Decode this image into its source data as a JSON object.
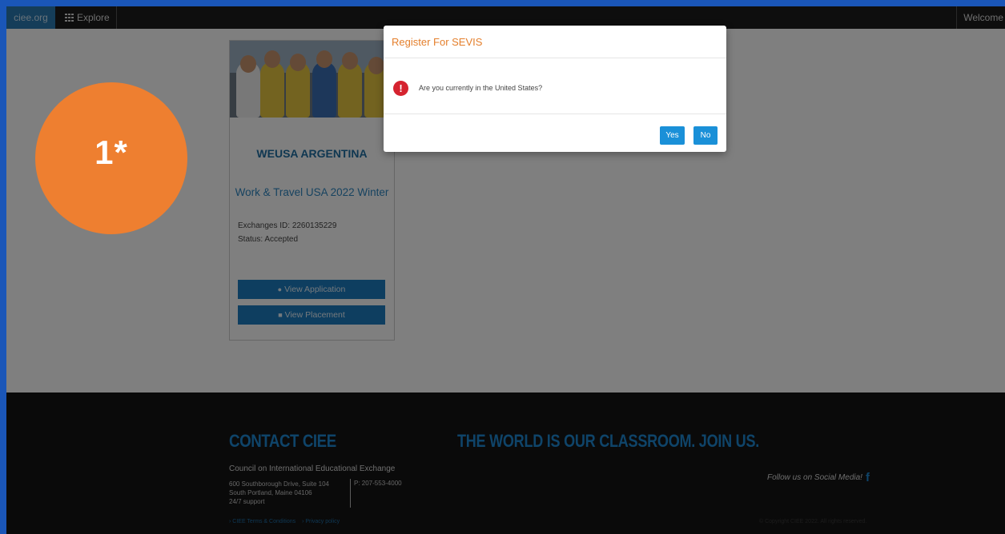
{
  "nav": {
    "brand": "ciee.org",
    "explore": "Explore",
    "welcome": "Welcome"
  },
  "card": {
    "title": "WEUSA ARGENTINA",
    "program": "Work & Travel USA 2022 Winter",
    "exchanges_id": "Exchanges ID: 2260135229",
    "status": "Status: Accepted",
    "view_application": "View Application",
    "view_placement": "View Placement"
  },
  "modal": {
    "title": "Register For SEVIS",
    "question": "Are you currently in the United States?",
    "yes": "Yes",
    "no": "No"
  },
  "badge": {
    "label": "1*"
  },
  "footer": {
    "contact_heading": "CONTACT CIEE",
    "slogan": "THE WORLD IS OUR CLASSROOM. JOIN US.",
    "org": "Council on International Educational Exchange",
    "address_line1": "600 Southborough Drive, Suite 104",
    "address_line2": "South Portland, Maine 04106",
    "address_line3": "24/7 support",
    "phone": "P: 207-553-4000",
    "social": "Follow us on Social Media!",
    "facebook": "f",
    "terms": "› CIEE Terms & Conditions",
    "privacy": "› Privacy policy",
    "copyright": "© Copyright CIEE 2022. All rights reserved."
  },
  "colors": {
    "accent_orange": "#ee7f30",
    "primary_blue": "#1c7cc0",
    "danger_red": "#d5232f"
  }
}
